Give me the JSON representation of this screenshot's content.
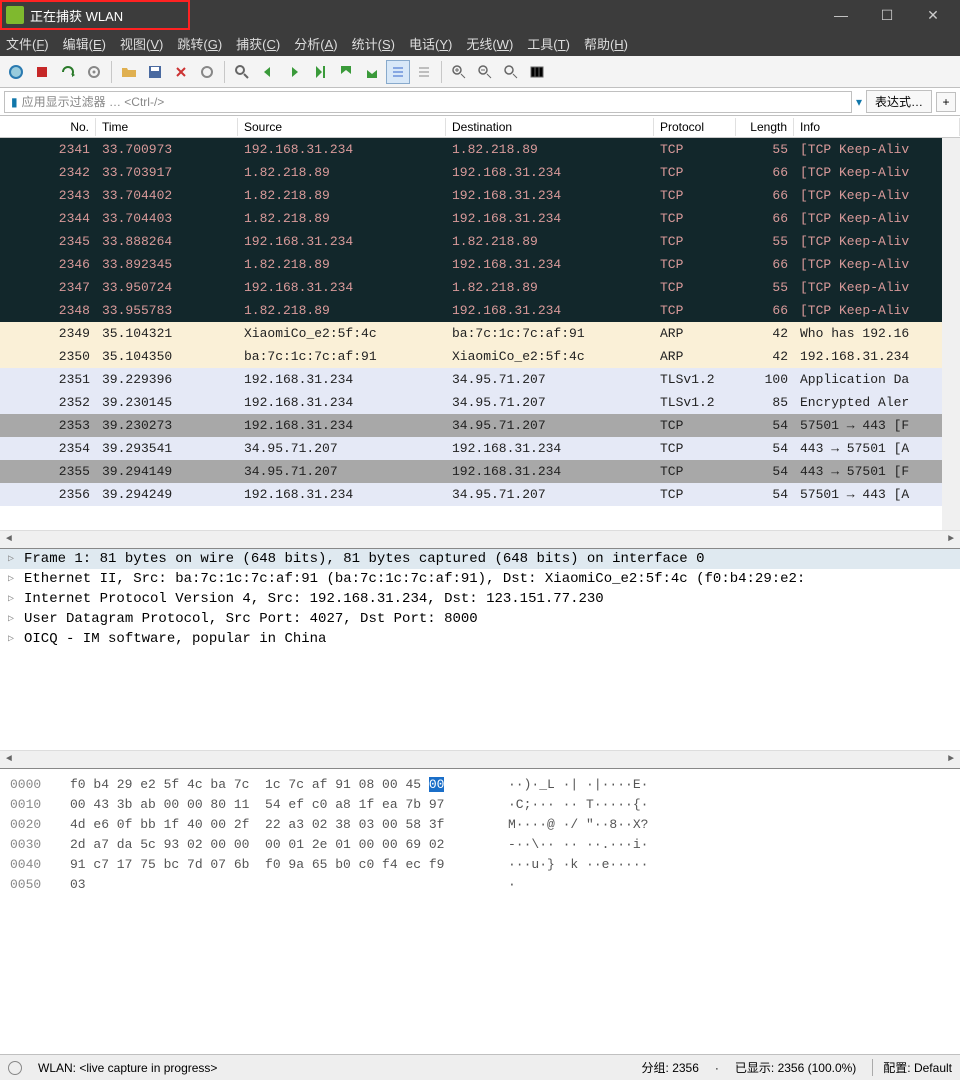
{
  "title": "正在捕获 WLAN",
  "menu": [
    "文件(F)",
    "编辑(E)",
    "视图(V)",
    "跳转(G)",
    "捕获(C)",
    "分析(A)",
    "统计(S)",
    "电话(Y)",
    "无线(W)",
    "工具(T)",
    "帮助(H)"
  ],
  "filter_placeholder": "应用显示过滤器 … <Ctrl-/>",
  "expression_btn": "表达式…",
  "columns": {
    "no": "No.",
    "time": "Time",
    "src": "Source",
    "dst": "Destination",
    "proto": "Protocol",
    "len": "Length",
    "info": "Info"
  },
  "rows": [
    {
      "no": "2341",
      "time": "33.700973",
      "src": "192.168.31.234",
      "dst": "1.82.218.89",
      "proto": "TCP",
      "len": "55",
      "info": "[TCP Keep-Aliv",
      "cls": "bg-dark"
    },
    {
      "no": "2342",
      "time": "33.703917",
      "src": "1.82.218.89",
      "dst": "192.168.31.234",
      "proto": "TCP",
      "len": "66",
      "info": "[TCP Keep-Aliv",
      "cls": "bg-dark"
    },
    {
      "no": "2343",
      "time": "33.704402",
      "src": "1.82.218.89",
      "dst": "192.168.31.234",
      "proto": "TCP",
      "len": "66",
      "info": "[TCP Keep-Aliv",
      "cls": "bg-dark"
    },
    {
      "no": "2344",
      "time": "33.704403",
      "src": "1.82.218.89",
      "dst": "192.168.31.234",
      "proto": "TCP",
      "len": "66",
      "info": "[TCP Keep-Aliv",
      "cls": "bg-dark"
    },
    {
      "no": "2345",
      "time": "33.888264",
      "src": "192.168.31.234",
      "dst": "1.82.218.89",
      "proto": "TCP",
      "len": "55",
      "info": "[TCP Keep-Aliv",
      "cls": "bg-dark"
    },
    {
      "no": "2346",
      "time": "33.892345",
      "src": "1.82.218.89",
      "dst": "192.168.31.234",
      "proto": "TCP",
      "len": "66",
      "info": "[TCP Keep-Aliv",
      "cls": "bg-dark"
    },
    {
      "no": "2347",
      "time": "33.950724",
      "src": "192.168.31.234",
      "dst": "1.82.218.89",
      "proto": "TCP",
      "len": "55",
      "info": "[TCP Keep-Aliv",
      "cls": "bg-dark"
    },
    {
      "no": "2348",
      "time": "33.955783",
      "src": "1.82.218.89",
      "dst": "192.168.31.234",
      "proto": "TCP",
      "len": "66",
      "info": "[TCP Keep-Aliv",
      "cls": "bg-dark"
    },
    {
      "no": "2349",
      "time": "35.104321",
      "src": "XiaomiCo_e2:5f:4c",
      "dst": "ba:7c:1c:7c:af:91",
      "proto": "ARP",
      "len": "42",
      "info": "Who has 192.16",
      "cls": "bg-arp"
    },
    {
      "no": "2350",
      "time": "35.104350",
      "src": "ba:7c:1c:7c:af:91",
      "dst": "XiaomiCo_e2:5f:4c",
      "proto": "ARP",
      "len": "42",
      "info": "192.168.31.234",
      "cls": "bg-arp"
    },
    {
      "no": "2351",
      "time": "39.229396",
      "src": "192.168.31.234",
      "dst": "34.95.71.207",
      "proto": "TLSv1.2",
      "len": "100",
      "info": "Application Da",
      "cls": "bg-tls"
    },
    {
      "no": "2352",
      "time": "39.230145",
      "src": "192.168.31.234",
      "dst": "34.95.71.207",
      "proto": "TLSv1.2",
      "len": "85",
      "info": "Encrypted Aler",
      "cls": "bg-tls"
    },
    {
      "no": "2353",
      "time": "39.230273",
      "src": "192.168.31.234",
      "dst": "34.95.71.207",
      "proto": "TCP",
      "len": "54",
      "info": "57501 → 443 [F",
      "cls": "bg-gray"
    },
    {
      "no": "2354",
      "time": "39.293541",
      "src": "34.95.71.207",
      "dst": "192.168.31.234",
      "proto": "TCP",
      "len": "54",
      "info": "443 → 57501 [A",
      "cls": "bg-tls"
    },
    {
      "no": "2355",
      "time": "39.294149",
      "src": "34.95.71.207",
      "dst": "192.168.31.234",
      "proto": "TCP",
      "len": "54",
      "info": "443 → 57501 [F",
      "cls": "bg-gray"
    },
    {
      "no": "2356",
      "time": "39.294249",
      "src": "192.168.31.234",
      "dst": "34.95.71.207",
      "proto": "TCP",
      "len": "54",
      "info": "57501 → 443 [A",
      "cls": "bg-tls"
    }
  ],
  "details": [
    "Frame 1: 81 bytes on wire (648 bits), 81 bytes captured (648 bits) on interface 0",
    "Ethernet II, Src: ba:7c:1c:7c:af:91 (ba:7c:1c:7c:af:91), Dst: XiaomiCo_e2:5f:4c (f0:b4:29:e2:",
    "Internet Protocol Version 4, Src: 192.168.31.234, Dst: 123.151.77.230",
    "User Datagram Protocol, Src Port: 4027, Dst Port: 8000",
    "OICQ - IM software, popular in China"
  ],
  "hex": [
    {
      "off": "0000",
      "hex": "f0 b4 29 e2 5f 4c ba 7c  1c 7c af 91 08 00 45 ",
      "hl": "00",
      "asc": "··)·_L ·| ·|····E·"
    },
    {
      "off": "0010",
      "hex": "00 43 3b ab 00 00 80 11  54 ef c0 a8 1f ea 7b 97",
      "asc": "·C;··· ·· T·····{·"
    },
    {
      "off": "0020",
      "hex": "4d e6 0f bb 1f 40 00 2f  22 a3 02 38 03 00 58 3f",
      "asc": "M····@ ·/ \"··8··X?"
    },
    {
      "off": "0030",
      "hex": "2d a7 da 5c 93 02 00 00  00 01 2e 01 00 00 69 02",
      "asc": "-··\\·· ·· ··.···i·"
    },
    {
      "off": "0040",
      "hex": "91 c7 17 75 bc 7d 07 6b  f0 9a 65 b0 c0 f4 ec f9",
      "asc": "···u·} ·k ··e·····"
    },
    {
      "off": "0050",
      "hex": "03",
      "asc": "·"
    }
  ],
  "status": {
    "iface": "WLAN: <live capture in progress>",
    "pkts": "分组: 2356",
    "disp": "已显示: 2356 (100.0%)",
    "profile": "配置: Default"
  }
}
